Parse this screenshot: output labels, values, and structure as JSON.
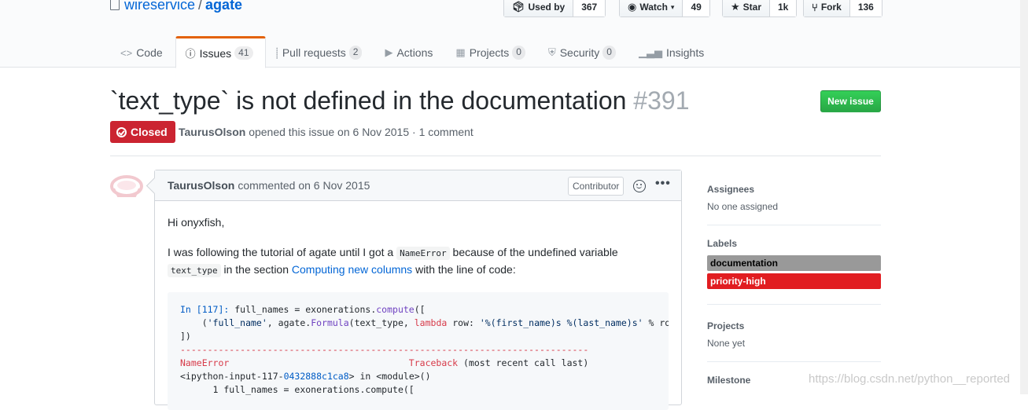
{
  "repo": {
    "owner": "wireservice",
    "separator": "/",
    "name": "agate"
  },
  "actions": [
    {
      "label": "Used by",
      "count": "367",
      "icon": "package-icon"
    },
    {
      "label": "Watch",
      "count": "49",
      "icon": "eye-icon"
    },
    {
      "label": "Star",
      "count": "1k",
      "icon": "star-icon"
    },
    {
      "label": "Fork",
      "count": "136",
      "icon": "fork-icon"
    }
  ],
  "nav": [
    {
      "label": "Code",
      "count": null
    },
    {
      "label": "Issues",
      "count": "41"
    },
    {
      "label": "Pull requests",
      "count": "2"
    },
    {
      "label": "Actions",
      "count": null
    },
    {
      "label": "Projects",
      "count": "0"
    },
    {
      "label": "Security",
      "count": "0"
    },
    {
      "label": "Insights",
      "count": null
    }
  ],
  "issue": {
    "title": "`text_type` is not defined in the documentation",
    "number": "#391",
    "state": "Closed",
    "author": "TaurusOlson",
    "meta_text": "opened this issue on 6 Nov 2015 · 1 comment",
    "new_issue_label": "New issue"
  },
  "comment": {
    "author": "TaurusOlson",
    "action": "commented on 6 Nov 2015",
    "role": "Contributor",
    "greeting": "Hi onyxfish,",
    "p2_a": "I was following the tutorial of agate until I got a ",
    "p2_code1": "NameError",
    "p2_b": " because of the undefined variable ",
    "p2_code2": "text_type",
    "p2_c": " in the section ",
    "p2_link": "Computing new columns",
    "p2_d": " with the line of code:",
    "code_in_prompt": "In [117]:",
    "code_line1_rest": " full_names = exonerations.",
    "code_line1_fn": "compute",
    "code_line1_end": "([",
    "code_line2_a": "    (",
    "code_line2_str1": "'full_name'",
    "code_line2_b": ", agate.",
    "code_line2_fn": "Formula",
    "code_line2_c": "(text_type, ",
    "code_line2_kw": "lambda",
    "code_line2_d": " row: ",
    "code_line2_str2": "'%(first_name)s %(last_name)s'",
    "code_line2_e": " % row))",
    "code_line3": "])",
    "code_line4": "---------------------------------------------------------------------------",
    "code_line5_err": "NameError",
    "code_line5_pad": "                                 ",
    "code_line5_tb": "Traceback",
    "code_line5_rest": " (most recent call last)",
    "code_line6_a": "<ipython-input-117-",
    "code_line6_hash": "0432888c1ca8",
    "code_line6_b": "> in <module>()",
    "code_line7": "      1 full_names = exonerations.compute(["
  },
  "sidebar": {
    "assignees_heading": "Assignees",
    "assignees_value": "No one assigned",
    "labels_heading": "Labels",
    "labels": [
      {
        "name": "documentation",
        "color": "#999999",
        "text_color": "#000000"
      },
      {
        "name": "priority-high",
        "color": "#e11d21",
        "text_color": "#ffffff"
      }
    ],
    "projects_heading": "Projects",
    "projects_value": "None yet",
    "milestone_heading": "Milestone"
  },
  "watermark": "https://blog.csdn.net/python__reported"
}
